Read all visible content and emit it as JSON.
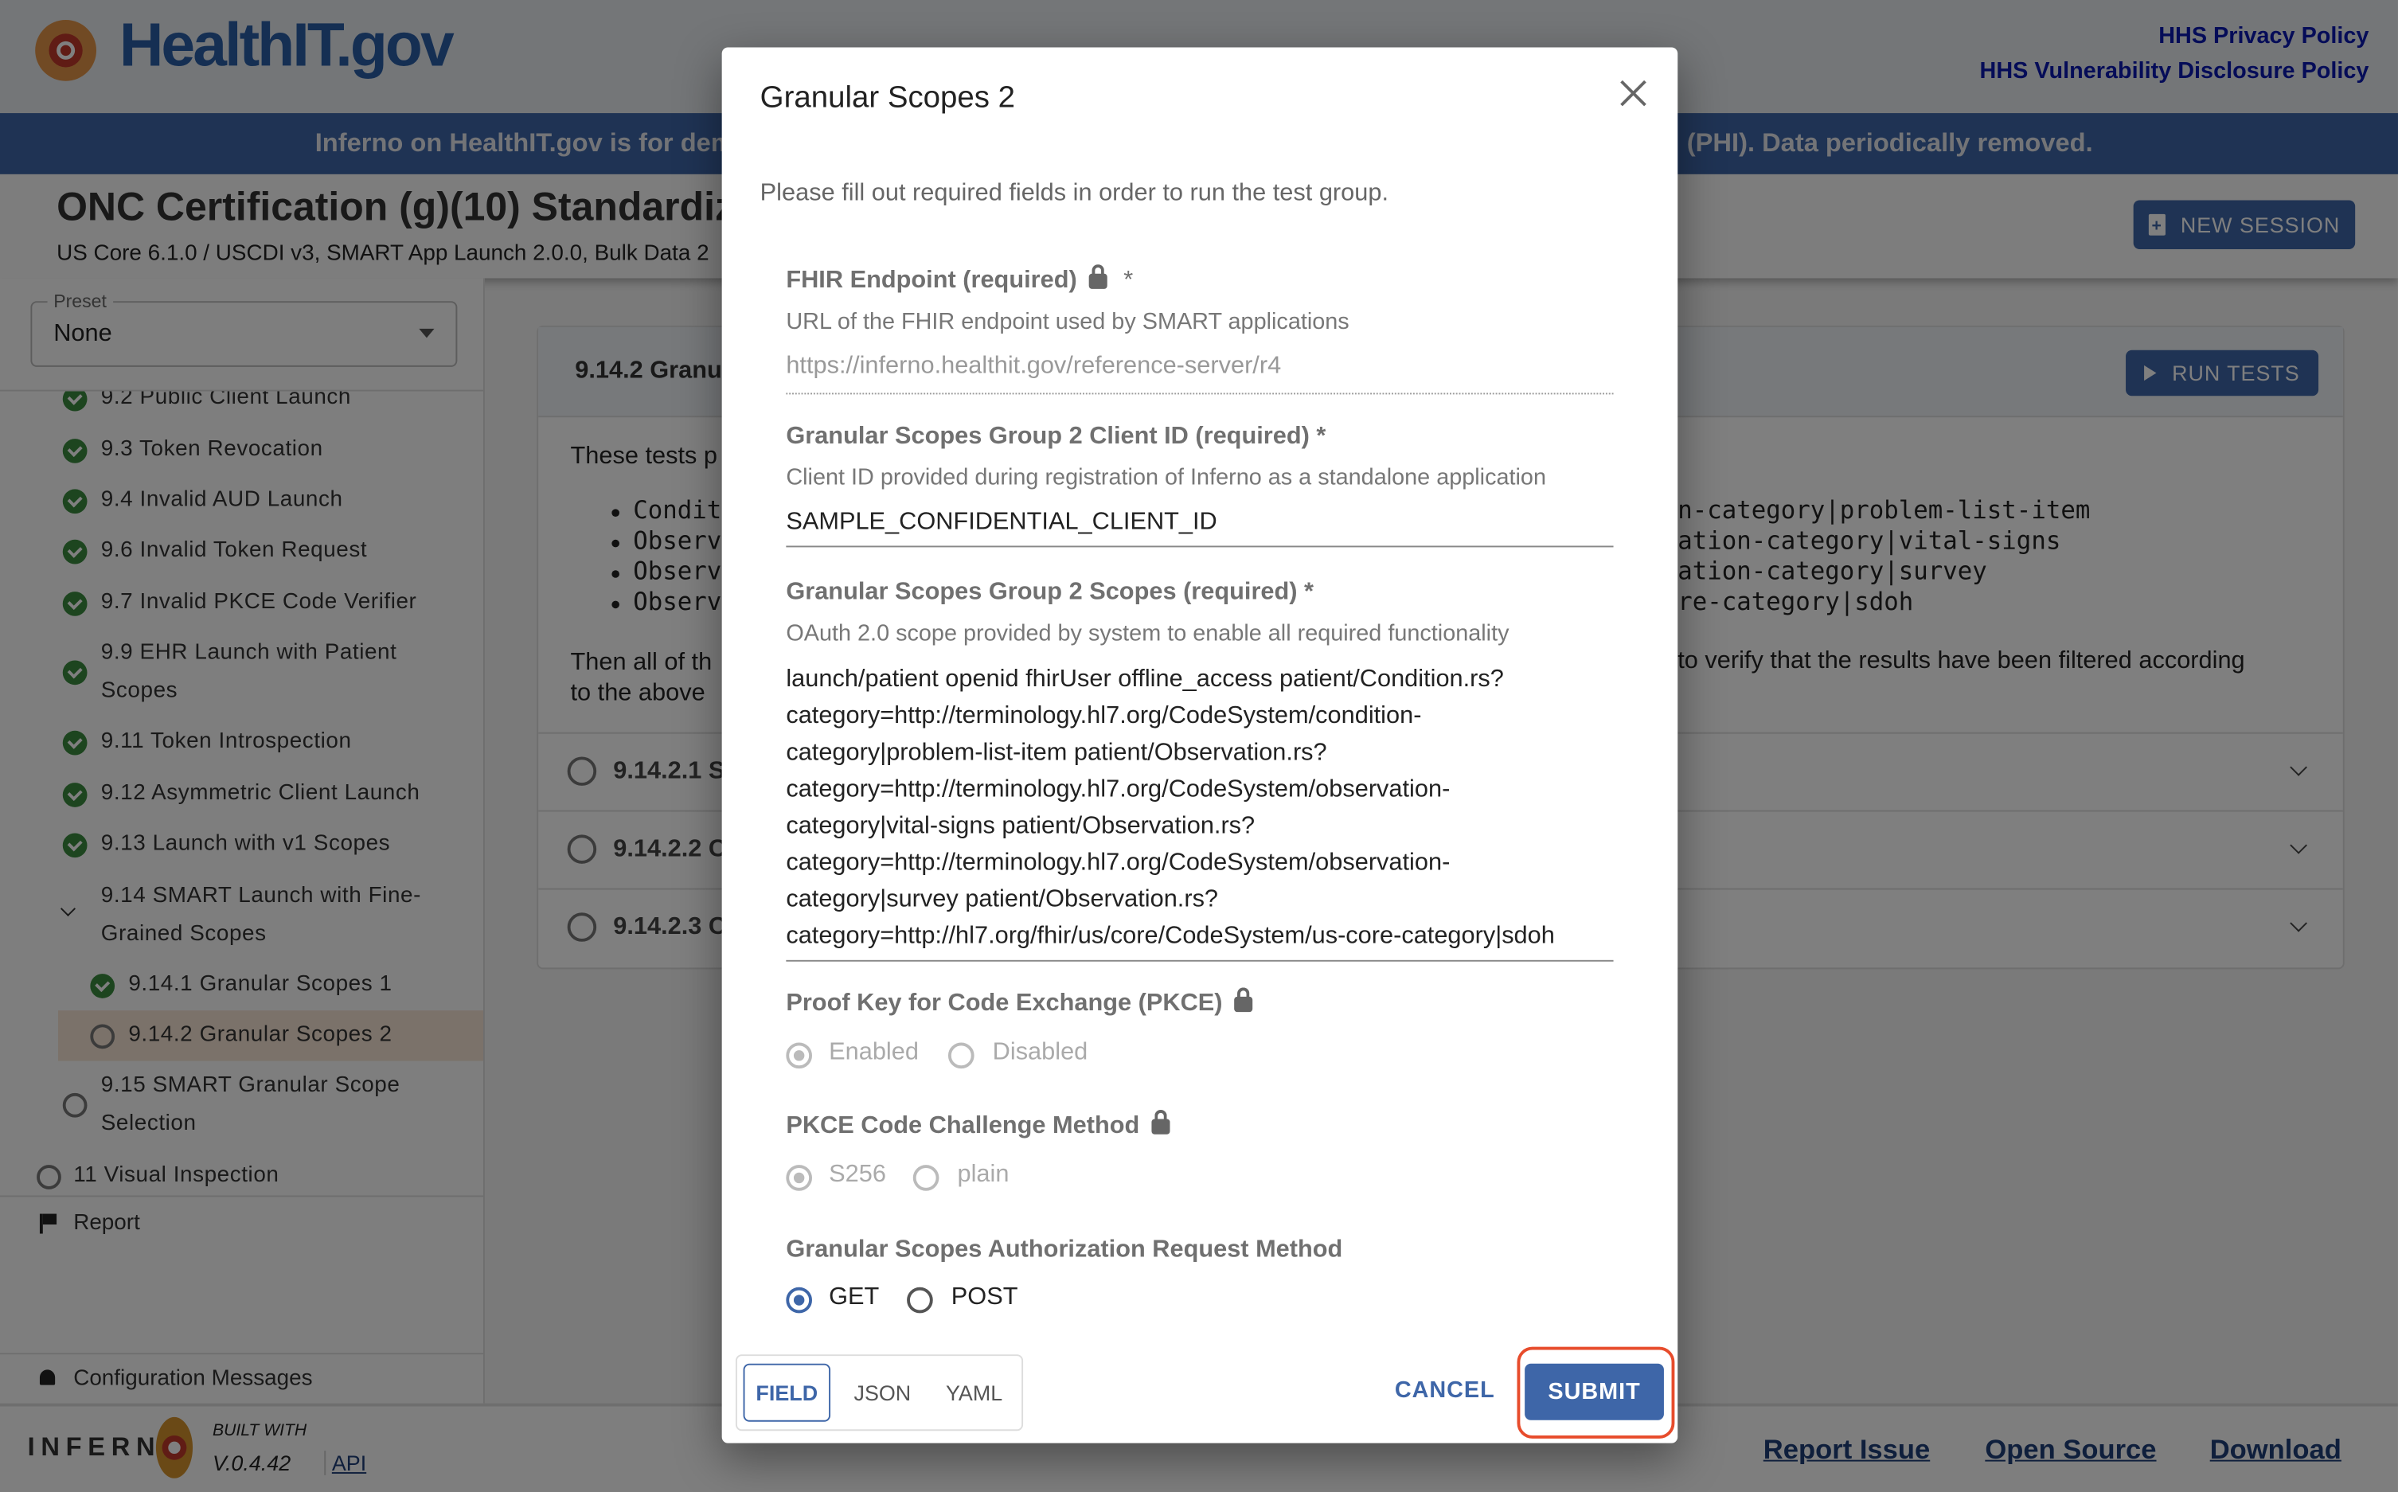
{
  "header": {
    "logo": "HealthIT.gov",
    "links": [
      "HHS Privacy Policy",
      "HHS Vulnerability Disclosure Policy"
    ]
  },
  "banner": {
    "left": "Inferno on HealthIT.gov is for dem",
    "right": "(PHI). Data periodically removed."
  },
  "titlebar": {
    "title": "ONC Certification (g)(10) Standardize",
    "subtitle": "US Core 6.1.0 / USCDI v3, SMART App Launch 2.0.0, Bulk Data 2",
    "new_session": "NEW SESSION"
  },
  "sidebar": {
    "preset_label": "Preset",
    "preset_value": "None",
    "items": [
      {
        "label": "9.2 Public Client Launch",
        "status": "pass"
      },
      {
        "label": "9.3 Token Revocation",
        "status": "pass"
      },
      {
        "label": "9.4 Invalid AUD Launch",
        "status": "pass"
      },
      {
        "label": "9.6 Invalid Token Request",
        "status": "pass"
      },
      {
        "label": "9.7 Invalid PKCE Code Verifier",
        "status": "pass"
      },
      {
        "label": "9.9 EHR Launch with Patient Scopes",
        "status": "pass"
      },
      {
        "label": "9.11 Token Introspection",
        "status": "pass"
      },
      {
        "label": "9.12 Asymmetric Client Launch",
        "status": "pass"
      },
      {
        "label": "9.13 Launch with v1 Scopes",
        "status": "pass"
      },
      {
        "label": "9.14 SMART Launch with Fine-Grained Scopes",
        "status": "expanded"
      },
      {
        "label": "9.14.1 Granular Scopes 1",
        "status": "pass"
      },
      {
        "label": "9.14.2 Granular Scopes 2",
        "status": "pending",
        "selected": true
      },
      {
        "label": "9.15 SMART Granular Scope Selection",
        "status": "pending"
      },
      {
        "label": "11 Visual Inspection",
        "status": "pending"
      }
    ],
    "report": "Report",
    "config_messages": "Configuration Messages"
  },
  "main": {
    "group_title": "9.14.2 Granu",
    "run_tests": "RUN TESTS",
    "intro_left": "These tests p",
    "bullets_left": [
      "Condit",
      "Observ",
      "Observ",
      "Observ"
    ],
    "bullets_right": [
      "n-category|problem-list-item",
      "ation-category|vital-signs",
      "ation-category|survey",
      "re-category|sdoh"
    ],
    "then_left": [
      "Then all of th",
      "to the above"
    ],
    "then_right": "to verify that the results have been filtered according",
    "tests": [
      "9.14.2.1 S",
      "9.14.2.2 C",
      "9.14.2.3 C"
    ]
  },
  "footer": {
    "built_with": "BUILT WITH",
    "version": "V.0.4.42",
    "api": "API",
    "logo": "INFERNO",
    "links": [
      "Report Issue",
      "Open Source",
      "Download"
    ]
  },
  "modal": {
    "title": "Granular Scopes 2",
    "instructions": "Please fill out required fields in order to run the test group.",
    "fhir": {
      "label": "FHIR Endpoint (required)",
      "required_mark": "*",
      "desc": "URL of the FHIR endpoint used by SMART applications",
      "value": "https://inferno.healthit.gov/reference-server/r4",
      "locked": true
    },
    "client_id": {
      "label": "Granular Scopes Group 2 Client ID (required) *",
      "desc": "Client ID provided during registration of Inferno as a standalone application",
      "value": "SAMPLE_CONFIDENTIAL_CLIENT_ID"
    },
    "scopes": {
      "label": "Granular Scopes Group 2 Scopes (required) *",
      "desc": "OAuth 2.0 scope provided by system to enable all required functionality",
      "value_lines": [
        "launch/patient openid fhirUser offline_access patient/Condition.rs?",
        "category=http://terminology.hl7.org/CodeSystem/condition-",
        "category|problem-list-item patient/Observation.rs?",
        "category=http://terminology.hl7.org/CodeSystem/observation-",
        "category|vital-signs patient/Observation.rs?",
        "category=http://terminology.hl7.org/CodeSystem/observation-",
        "category|survey patient/Observation.rs?",
        "category=http://hl7.org/fhir/us/core/CodeSystem/us-core-category|sdoh"
      ]
    },
    "pkce": {
      "label": "Proof Key for Code Exchange (PKCE)",
      "options": [
        "Enabled",
        "Disabled"
      ],
      "selected": "Enabled",
      "locked": true
    },
    "pkce_method": {
      "label": "PKCE Code Challenge Method",
      "options": [
        "S256",
        "plain"
      ],
      "selected": "S256",
      "locked": true
    },
    "auth_method": {
      "label": "Granular Scopes Authorization Request Method",
      "options": [
        "GET",
        "POST"
      ],
      "selected": "GET"
    },
    "view_tabs": [
      "FIELD",
      "JSON",
      "YAML"
    ],
    "active_tab": "FIELD",
    "cancel": "CANCEL",
    "submit": "SUBMIT"
  },
  "colors": {
    "accent": "#3e66a8",
    "highlight": "#e74c2c",
    "pass": "#3a8a3f"
  }
}
